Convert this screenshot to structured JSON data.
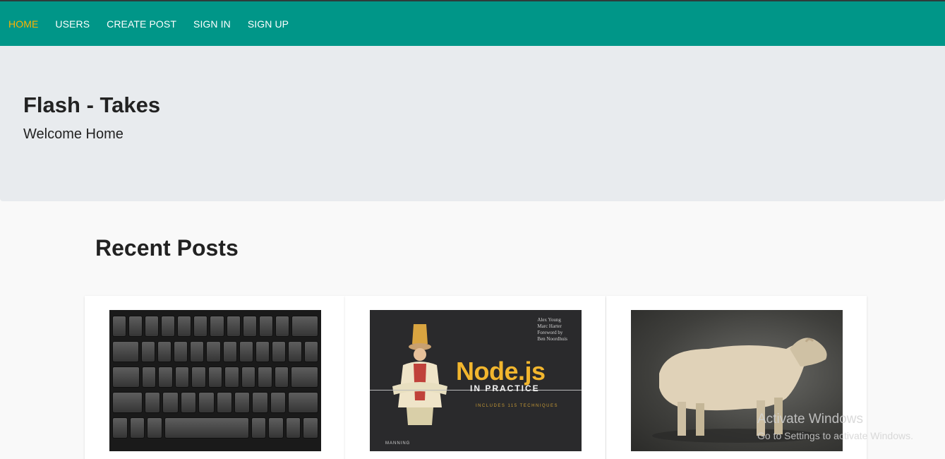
{
  "nav": {
    "items": [
      {
        "label": "HOME",
        "active": true
      },
      {
        "label": "USERS",
        "active": false
      },
      {
        "label": "CREATE POST",
        "active": false
      },
      {
        "label": "SIGN IN",
        "active": false
      },
      {
        "label": "SIGN UP",
        "active": false
      }
    ],
    "bg_color": "#009688",
    "active_color": "#ffb300"
  },
  "hero": {
    "title": "Flash - Takes",
    "subtitle": "Welcome Home"
  },
  "recent": {
    "title": "Recent Posts",
    "posts": [
      {
        "image": "keyboard-photo"
      },
      {
        "image": "nodejs-book-cover",
        "cover": {
          "authors": [
            "Alex Young",
            "Marc Harter"
          ],
          "foreword": "Foreword by",
          "foreword_name": "Ben Noordhuis",
          "title": "Node.js",
          "subtitle": "IN PRACTICE",
          "note": "INCLUDES 115 TECHNIQUES",
          "publisher": "MANNING"
        }
      },
      {
        "image": "sheep-photo"
      }
    ]
  },
  "watermark": {
    "title": "Activate Windows",
    "subtitle": "Go to Settings to activate Windows."
  }
}
